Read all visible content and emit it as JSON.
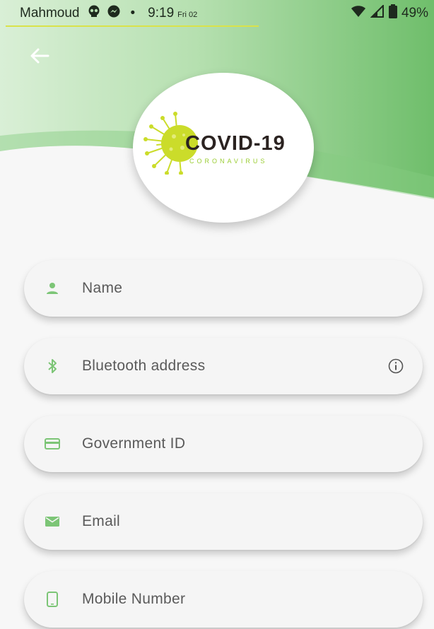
{
  "status_bar": {
    "carrier": "Mahmoud",
    "time": "9:19",
    "day": "Fri 02",
    "battery": "49%"
  },
  "header": {
    "back_icon": "arrow-left-icon"
  },
  "logo": {
    "title": "COVID-19",
    "subtitle": "CORONAVIRUS"
  },
  "form": {
    "fields": [
      {
        "placeholder": "Name",
        "icon": "person-icon"
      },
      {
        "placeholder": "Bluetooth address",
        "icon": "bluetooth-icon",
        "trailing_icon": "info-icon"
      },
      {
        "placeholder": "Government ID",
        "icon": "credit-card-icon"
      },
      {
        "placeholder": "Email",
        "icon": "email-icon"
      },
      {
        "placeholder": "Mobile Number",
        "icon": "smartphone-icon"
      }
    ]
  },
  "colors": {
    "accent": "#7cc576",
    "header_green": "#6cbd69",
    "logo_green": "#cbdc2a"
  }
}
